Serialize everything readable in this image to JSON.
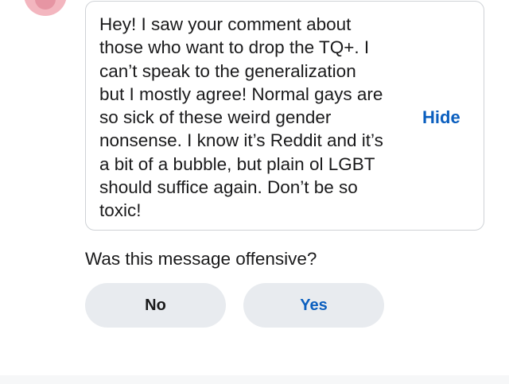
{
  "message": {
    "text": "Hey! I saw your comment about\nthose who want to drop the TQ+.  I\ncan’t speak to the generalization\nbut I mostly agree! Normal gays are\nso sick of these weird gender\nnonsense. I know it’s Reddit and it’s\na bit of a bubble, but plain ol LGBT\nshould suffice again.  Don’t be so\ntoxic!",
    "hide_label": "Hide"
  },
  "report": {
    "question": "Was this message offensive?",
    "no_label": "No",
    "yes_label": "Yes"
  },
  "colors": {
    "accent": "#0b5fbf",
    "button_bg": "#e8ebef",
    "bubble_border": "#cfd2d6",
    "avatar": "#f3b6bf"
  }
}
